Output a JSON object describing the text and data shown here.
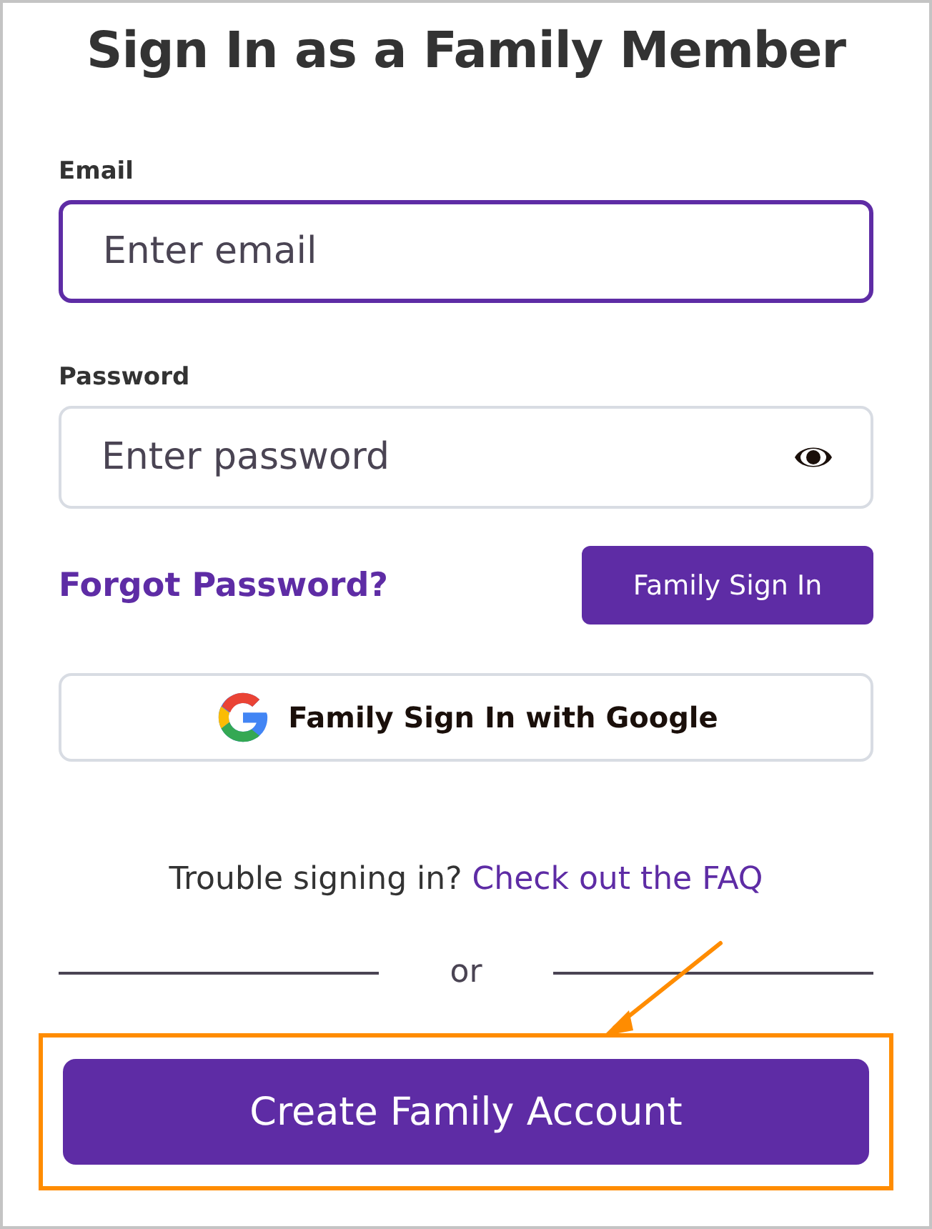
{
  "title": "Sign In as a Family Member",
  "email": {
    "label": "Email",
    "placeholder": "Enter email",
    "focused": true
  },
  "password": {
    "label": "Password",
    "placeholder": "Enter password"
  },
  "forgot_link": "Forgot Password?",
  "sign_in_button": "Family Sign In",
  "google_button": "Family Sign In with Google",
  "help": {
    "text": "Trouble signing in?",
    "link": "Check out the FAQ"
  },
  "divider": "or",
  "create_button": {
    "label": "Create Family Account",
    "highlighted": true
  }
}
